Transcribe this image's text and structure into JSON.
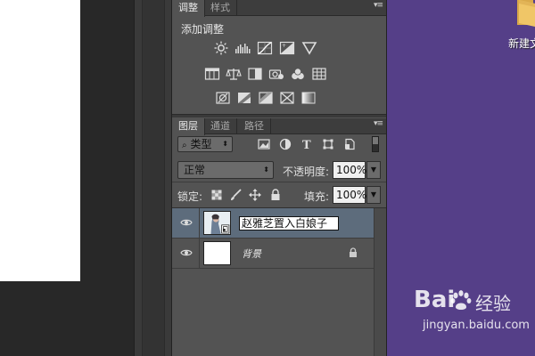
{
  "adjust_panel": {
    "tabs": [
      {
        "label": "调整"
      },
      {
        "label": "样式"
      }
    ],
    "title": "添加调整",
    "icons": [
      "brightness-contrast-icon",
      "levels-icon",
      "curves-icon",
      "exposure-icon",
      "vibrance-icon",
      "hue-saturation-icon",
      "color-balance-icon",
      "black-white-icon",
      "photo-filter-icon",
      "channel-mixer-icon",
      "color-lookup-icon",
      "invert-icon",
      "posterize-icon",
      "threshold-icon",
      "selective-color-icon",
      "gradient-map-icon"
    ]
  },
  "layers_panel": {
    "tabs": [
      {
        "label": "图层"
      },
      {
        "label": "通道"
      },
      {
        "label": "路径"
      }
    ],
    "filter_kind": "类型",
    "blend_mode": "正常",
    "opacity_label": "不透明度:",
    "opacity_value": "100%",
    "lock_label": "锁定:",
    "fill_label": "填充:",
    "fill_value": "100%",
    "layers": [
      {
        "name": "赵雅芝置入白娘子",
        "selected": true,
        "editing": true
      },
      {
        "name": "背景",
        "selected": false,
        "locked": true
      }
    ]
  },
  "desktop": {
    "icon_label": "新建文",
    "watermark": {
      "logo_a": "Bai",
      "logo_b": "经验",
      "url": "jingyan.baidu.com"
    }
  },
  "colors": {
    "panel": "#535353",
    "selected_row": "#5d6c7c",
    "desktop": "#553f88"
  }
}
